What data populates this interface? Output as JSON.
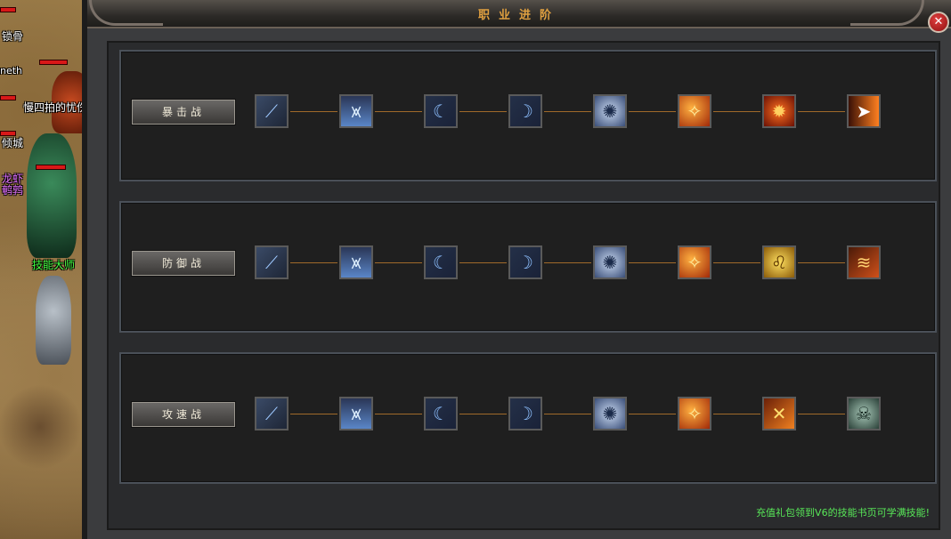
{
  "window": {
    "title": "职业进阶",
    "close_symbol": "✕"
  },
  "world": {
    "npc_labels": [
      "锁骨",
      "neth",
      "慢四拍的忧伤",
      "倾城",
      "龙虾",
      "鹌鹑",
      "技能大师"
    ]
  },
  "classes": [
    {
      "label": "暴击战",
      "skills": [
        {
          "icon": "sword-icon",
          "glyph": "⟋"
        },
        {
          "icon": "ice-spike-icon",
          "glyph": "⩙"
        },
        {
          "icon": "crescent-slash-icon",
          "glyph": "☾"
        },
        {
          "icon": "crescent-moon-icon",
          "glyph": "☽"
        },
        {
          "icon": "whirlwind-icon",
          "glyph": "✺"
        },
        {
          "icon": "fire-slash-icon",
          "glyph": "✧"
        },
        {
          "icon": "fire-dragon-icon",
          "glyph": "✹"
        },
        {
          "icon": "fire-bolt-icon",
          "glyph": "➤"
        }
      ]
    },
    {
      "label": "防御战",
      "skills": [
        {
          "icon": "sword-icon",
          "glyph": "⟋"
        },
        {
          "icon": "ice-spike-icon",
          "glyph": "⩙"
        },
        {
          "icon": "crescent-slash-icon",
          "glyph": "☾"
        },
        {
          "icon": "crescent-moon-icon",
          "glyph": "☽"
        },
        {
          "icon": "whirlwind-icon",
          "glyph": "✺"
        },
        {
          "icon": "fire-slash-icon",
          "glyph": "✧"
        },
        {
          "icon": "golden-lion-icon",
          "glyph": "♌"
        },
        {
          "icon": "flame-sweep-icon",
          "glyph": "≋"
        }
      ]
    },
    {
      "label": "攻速战",
      "skills": [
        {
          "icon": "sword-icon",
          "glyph": "⟋"
        },
        {
          "icon": "ice-spike-icon",
          "glyph": "⩙"
        },
        {
          "icon": "crescent-slash-icon",
          "glyph": "☾"
        },
        {
          "icon": "crescent-moon-icon",
          "glyph": "☽"
        },
        {
          "icon": "whirlwind-icon",
          "glyph": "✺"
        },
        {
          "icon": "fire-slash-icon",
          "glyph": "✧"
        },
        {
          "icon": "crossed-blades-icon",
          "glyph": "✕"
        },
        {
          "icon": "dark-skull-icon",
          "glyph": "☠"
        }
      ]
    }
  ],
  "footer_hint": "充值礼包领到V6的技能书页可学满技能!",
  "colors": {
    "title": "#e0a040",
    "hint": "#58e858",
    "connector": "#a06a2a"
  }
}
